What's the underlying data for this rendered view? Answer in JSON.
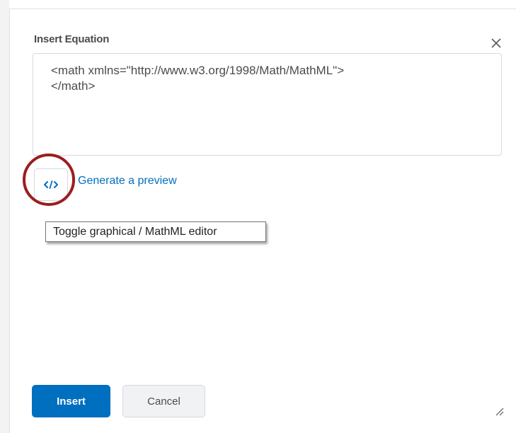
{
  "dialog": {
    "title": "Insert Equation",
    "editor_text": "<math xmlns=\"http://www.w3.org/1998/Math/MathML\">\n</math>",
    "preview_link": "Generate a preview",
    "tooltip": "Toggle graphical / MathML editor",
    "insert_label": "Insert",
    "cancel_label": "Cancel"
  },
  "icons": {
    "close": "close-icon",
    "toggle": "code-icon",
    "resize": "resize-handle-icon"
  },
  "colors": {
    "primary": "#006fbf",
    "highlight_ring": "#9b1d20",
    "text": "#494c4e"
  }
}
